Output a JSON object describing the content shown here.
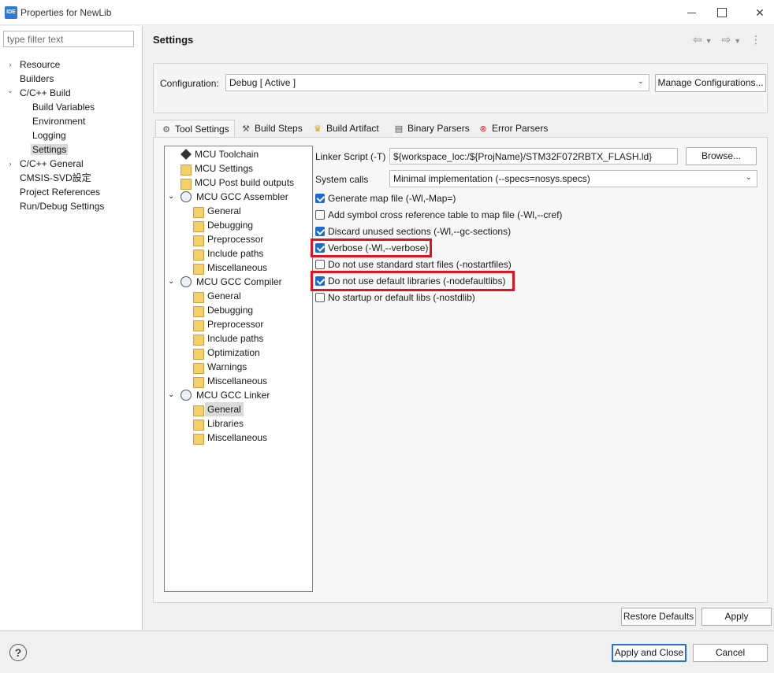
{
  "window": {
    "app_icon": "IDE",
    "title": "Properties for NewLib"
  },
  "left": {
    "filter_placeholder": "type filter text",
    "items": [
      {
        "label": "Resource",
        "arrow": "›"
      },
      {
        "label": "Builders",
        "arrow": ""
      },
      {
        "label": "C/C++ Build",
        "arrow": "⌄"
      },
      {
        "label": "Build Variables",
        "arrow": ""
      },
      {
        "label": "Environment",
        "arrow": ""
      },
      {
        "label": "Logging",
        "arrow": ""
      },
      {
        "label": "Settings",
        "arrow": ""
      },
      {
        "label": "C/C++ General",
        "arrow": "›"
      },
      {
        "label": "CMSIS-SVD設定",
        "arrow": ""
      },
      {
        "label": "Project References",
        "arrow": ""
      },
      {
        "label": "Run/Debug Settings",
        "arrow": ""
      }
    ]
  },
  "header": {
    "title": "Settings"
  },
  "config": {
    "label": "Configuration:",
    "value": "Debug  [ Active ]",
    "manage_button": "Manage Configurations..."
  },
  "tabs": [
    {
      "label": "Tool Settings"
    },
    {
      "label": "Build Steps"
    },
    {
      "label": "Build Artifact"
    },
    {
      "label": "Binary Parsers"
    },
    {
      "label": "Error Parsers"
    }
  ],
  "tool_tree": [
    {
      "label": "MCU Toolchain"
    },
    {
      "label": "MCU Settings"
    },
    {
      "label": "MCU Post build outputs"
    },
    {
      "label": "MCU GCC Assembler"
    },
    {
      "label": "General"
    },
    {
      "label": "Debugging"
    },
    {
      "label": "Preprocessor"
    },
    {
      "label": "Include paths"
    },
    {
      "label": "Miscellaneous"
    },
    {
      "label": "MCU GCC Compiler"
    },
    {
      "label": "General"
    },
    {
      "label": "Debugging"
    },
    {
      "label": "Preprocessor"
    },
    {
      "label": "Include paths"
    },
    {
      "label": "Optimization"
    },
    {
      "label": "Warnings"
    },
    {
      "label": "Miscellaneous"
    },
    {
      "label": "MCU GCC Linker"
    },
    {
      "label": "General"
    },
    {
      "label": "Libraries"
    },
    {
      "label": "Miscellaneous"
    }
  ],
  "linker": {
    "script_label": "Linker Script (-T)",
    "script_value": "${workspace_loc:/${ProjName}/STM32F072RBTX_FLASH.ld}",
    "browse_button": "Browse...",
    "syscalls_label": "System calls",
    "syscalls_value": "Minimal implementation (--specs=nosys.specs)",
    "options": [
      {
        "label": "Generate map file (-Wl,-Map=)",
        "checked": true
      },
      {
        "label": "Add symbol cross reference table to map file (-Wl,--cref)",
        "checked": false
      },
      {
        "label": "Discard unused sections (-Wl,--gc-sections)",
        "checked": true
      },
      {
        "label": "Verbose (-Wl,--verbose)",
        "checked": true
      },
      {
        "label": "Do not use standard start files (-nostartfiles)",
        "checked": false
      },
      {
        "label": "Do not use default libraries (-nodefaultlibs)",
        "checked": true
      },
      {
        "label": "No startup or default libs (-nostdlib)",
        "checked": false
      }
    ]
  },
  "buttons": {
    "restore_defaults": "Restore Defaults",
    "apply": "Apply",
    "apply_close": "Apply and Close",
    "cancel": "Cancel",
    "help": "?"
  },
  "colors": {
    "highlight": "#e0141e",
    "checkbox": "#1a6bd0"
  }
}
